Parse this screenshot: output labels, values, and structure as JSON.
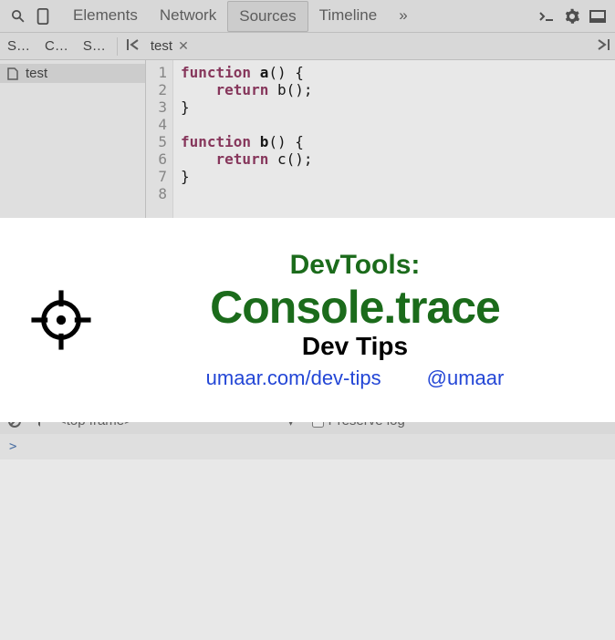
{
  "toolbar": {
    "tabs": [
      "Elements",
      "Network",
      "Sources",
      "Timeline"
    ],
    "active_tab": "Sources",
    "overflow_label": "»"
  },
  "sub_tabs": {
    "short_tabs": [
      "S…",
      "C…",
      "S…"
    ],
    "open_file": "test"
  },
  "file_tree": {
    "items": [
      {
        "name": "test"
      }
    ]
  },
  "code": {
    "line_numbers": [
      "1",
      "2",
      "3",
      "4",
      "5",
      "6",
      "7",
      "8"
    ],
    "lines": [
      "function a() {",
      "    return b();",
      "}",
      "",
      "function b() {",
      "    return c();",
      "}",
      ""
    ]
  },
  "console_bar": {
    "frame_label": "<top frame>",
    "preserve_log_label": "Preserve log"
  },
  "console_prompt": {
    "symbol": ">"
  },
  "overlay": {
    "line1": "DevTools:",
    "line2": "Console.trace",
    "line3": "Dev Tips",
    "link1": "umaar.com/dev-tips",
    "link2": "@umaar"
  }
}
